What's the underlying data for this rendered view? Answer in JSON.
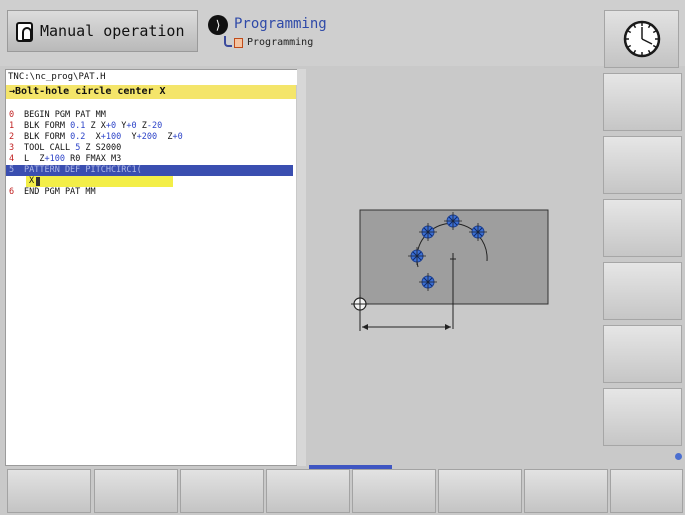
{
  "header": {
    "mode_manual_label": "Manual operation",
    "mode_programming_label": "Programming",
    "mode_programming_sublabel": "Programming"
  },
  "icons": {
    "manual": "hand-icon",
    "programming": "programming-mode-icon",
    "clock": "clock-icon"
  },
  "editor": {
    "file_path": "TNC:\\nc_prog\\PAT.H",
    "hint": "→Bolt-hole circle center X",
    "lines": [
      {
        "num": "0",
        "parts": [
          {
            "t": "BEGIN PGM PAT MM",
            "c": "k"
          }
        ]
      },
      {
        "num": "1",
        "parts": [
          {
            "t": "BLK FORM ",
            "c": "k"
          },
          {
            "t": "0.1",
            "c": "p"
          },
          {
            "t": " Z X",
            "c": "k"
          },
          {
            "t": "+0",
            "c": "p"
          },
          {
            "t": " Y",
            "c": "k"
          },
          {
            "t": "+0",
            "c": "p"
          },
          {
            "t": " Z",
            "c": "k"
          },
          {
            "t": "-20",
            "c": "p"
          }
        ]
      },
      {
        "num": "2",
        "parts": [
          {
            "t": "BLK FORM ",
            "c": "k"
          },
          {
            "t": "0.2",
            "c": "p"
          },
          {
            "t": "  X",
            "c": "k"
          },
          {
            "t": "+100",
            "c": "p"
          },
          {
            "t": "  Y",
            "c": "k"
          },
          {
            "t": "+200",
            "c": "p"
          },
          {
            "t": "  Z",
            "c": "k"
          },
          {
            "t": "+0",
            "c": "p"
          }
        ]
      },
      {
        "num": "3",
        "parts": [
          {
            "t": "TOOL CALL ",
            "c": "k"
          },
          {
            "t": "5",
            "c": "p"
          },
          {
            "t": " Z S2000",
            "c": "k"
          }
        ]
      },
      {
        "num": "4",
        "parts": [
          {
            "t": "L  Z",
            "c": "k"
          },
          {
            "t": "+100",
            "c": "p"
          },
          {
            "t": " R0 FMAX M3",
            "c": "k"
          }
        ]
      },
      {
        "num": "5",
        "parts": [
          {
            "t": "PATTERN DEF PITCHCIRC1(",
            "c": "k"
          }
        ],
        "selected": true
      },
      {
        "num": "6",
        "parts": [
          {
            "t": "END PGM PAT MM",
            "c": "k"
          }
        ]
      }
    ],
    "input_label": "X"
  },
  "colors": {
    "selection": "#3a4eb0",
    "hint_bar": "#f4e56a",
    "line_number": "#c01e1e",
    "parameter": "#2d44c8",
    "hole_marker": "#3b6fd6"
  },
  "graphics": {
    "workpiece_color": "#9e9e9e",
    "holes": 5
  }
}
